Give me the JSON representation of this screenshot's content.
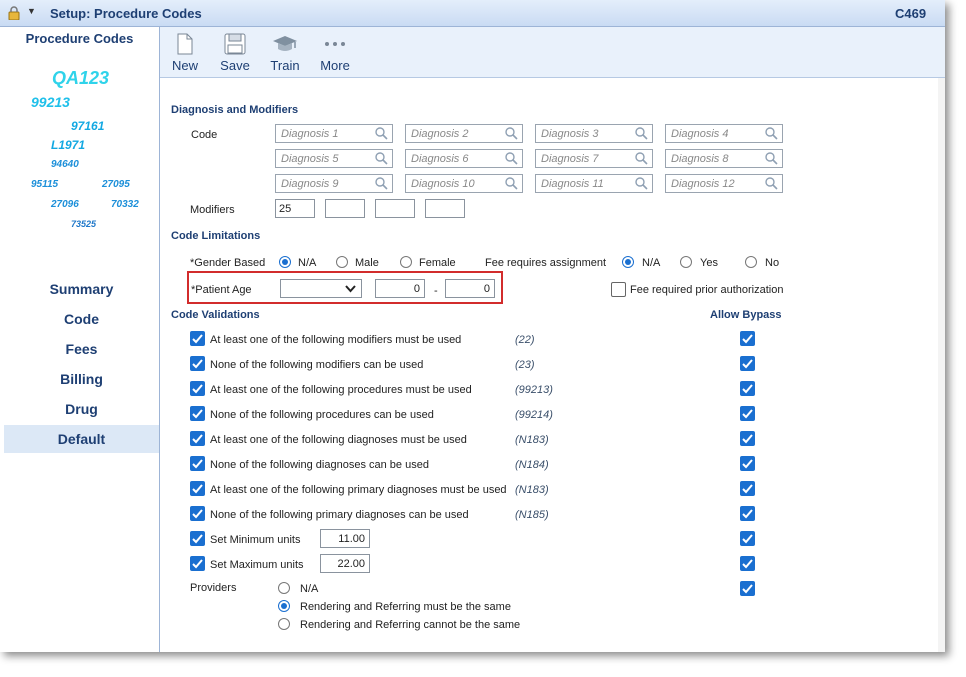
{
  "window": {
    "title": "Setup: Procedure Codes",
    "right_text": "C469"
  },
  "left": {
    "heading": "Procedure Codes",
    "cloud": [
      "QA123",
      "99213",
      "97161",
      "L1971",
      "94640",
      "95115",
      "27095",
      "27096",
      "70332",
      "73525"
    ],
    "nav": [
      "Summary",
      "Code",
      "Fees",
      "Billing",
      "Drug",
      "Default"
    ],
    "active": "Default"
  },
  "toolbar": {
    "new": "New",
    "save": "Save",
    "train": "Train",
    "more": "More"
  },
  "diagnosis": {
    "section": "Diagnosis and Modifiers",
    "code_label": "Code",
    "placeholders": [
      "Diagnosis 1",
      "Diagnosis 2",
      "Diagnosis 3",
      "Diagnosis 4",
      "Diagnosis 5",
      "Diagnosis 6",
      "Diagnosis 7",
      "Diagnosis 8",
      "Diagnosis 9",
      "Diagnosis 10",
      "Diagnosis 11",
      "Diagnosis 12"
    ],
    "modifiers_label": "Modifiers",
    "modifiers": [
      "25",
      "",
      "",
      ""
    ]
  },
  "limitations": {
    "section": "Code Limitations",
    "gender_label": "*Gender Based",
    "gender_options": [
      "N/A",
      "Male",
      "Female"
    ],
    "gender_selected": "N/A",
    "fee_label": "Fee requires assignment",
    "fee_options": [
      "N/A",
      "Yes",
      "No"
    ],
    "fee_selected": "N/A",
    "age_label": "*Patient Age",
    "age_select": "",
    "age_min": "0",
    "age_dash": "-",
    "age_max": "0",
    "prior_auth_label": "Fee required prior authorization",
    "prior_auth_checked": false
  },
  "validations": {
    "section": "Code Validations",
    "bypass_label": "Allow Bypass",
    "rows": [
      {
        "label": "At least one of the following modifiers must be used",
        "code": "(22)"
      },
      {
        "label": "None of the following modifiers can be used",
        "code": "(23)"
      },
      {
        "label": "At least one of the following procedures must be used",
        "code": "(99213)"
      },
      {
        "label": "None of the following procedures can be used",
        "code": "(99214)"
      },
      {
        "label": "At least one of the following diagnoses must be used",
        "code": "(N183)"
      },
      {
        "label": "None of the following diagnoses can be used",
        "code": "(N184)"
      },
      {
        "label": "At least one of the following primary diagnoses must be used",
        "code": "(N183)"
      },
      {
        "label": "None of the following primary diagnoses can be used",
        "code": "(N185)"
      }
    ],
    "min_units_label": "Set Minimum units",
    "min_units": "11.00",
    "max_units_label": "Set Maximum units",
    "max_units": "22.00",
    "providers_label": "Providers",
    "provider_options": [
      "N/A",
      "Rendering and Referring must be the same",
      "Rendering and Referring cannot be the same"
    ],
    "provider_selected": "Rendering and Referring must be the same"
  },
  "colors": {
    "accent": "#1a6fd0",
    "navy": "#1e3f73",
    "highlight": "#d22c2c"
  }
}
